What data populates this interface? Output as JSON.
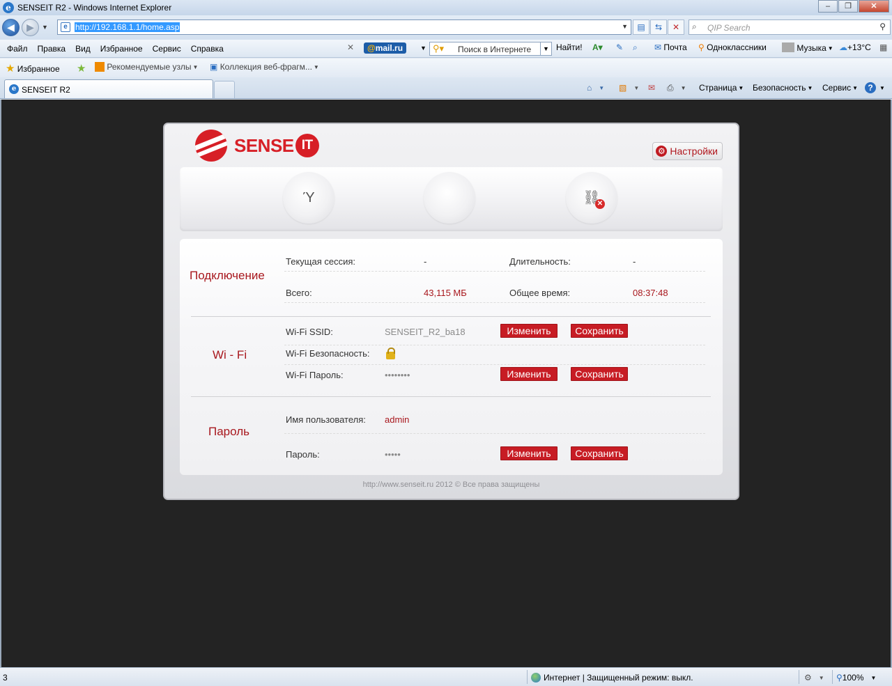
{
  "window": {
    "title": "SENSEIT R2 - Windows Internet Explorer"
  },
  "addressbar": {
    "url": "http://192.168.1.1/home.asp",
    "search_placeholder": "QIP Search"
  },
  "menu": {
    "items": [
      "Файл",
      "Правка",
      "Вид",
      "Избранное",
      "Сервис",
      "Справка"
    ]
  },
  "toolbar": {
    "mailru": "mail.ru",
    "search_text": "Поиск в Интернете",
    "find_label": "Найти!",
    "mail_label": "Почта",
    "ok_label": "Одноклассники",
    "music_label": "Музыка",
    "weather": "+13°C"
  },
  "favorites": {
    "favorites_label": "Избранное",
    "suggested_label": "Рекомендуемые узлы",
    "gallery_label": "Коллекция веб-фрагм..."
  },
  "tabs": {
    "active_label": "SENSEIT R2"
  },
  "commandbar": {
    "page_label": "Страница",
    "safety_label": "Безопасность",
    "tools_label": "Сервис"
  },
  "page": {
    "logo_text": "SENSE",
    "logo_it": "IT",
    "settings_label": "Настройки",
    "connection": {
      "title": "Подключение",
      "current_session_label": "Текущая сессия:",
      "current_session_value": "-",
      "duration_label": "Длительность:",
      "duration_value": "-",
      "total_label": "Всего:",
      "total_value": "43,115 МБ",
      "total_time_label": "Общее время:",
      "total_time_value": "08:37:48"
    },
    "wifi": {
      "title": "Wi - Fi",
      "ssid_label": "Wi-Fi SSID:",
      "ssid_value": "SENSEIT_R2_ba18",
      "security_label": "Wi-Fi Безопасность:",
      "password_label": "Wi-Fi Пароль:",
      "password_value": "••••••••",
      "change_label": "Изменить",
      "save_label": "Сохранить"
    },
    "password": {
      "title": "Пароль",
      "username_label": "Имя пользователя:",
      "username_value": "admin",
      "password_label": "Пароль:",
      "password_value": "•••••",
      "change_label": "Изменить",
      "save_label": "Сохранить"
    },
    "footer": "http://www.senseit.ru 2012 © Все права защищены"
  },
  "statusbar": {
    "left_text": "3",
    "zone_text": "Интернет | Защищенный режим: выкл.",
    "zoom": "100%"
  }
}
